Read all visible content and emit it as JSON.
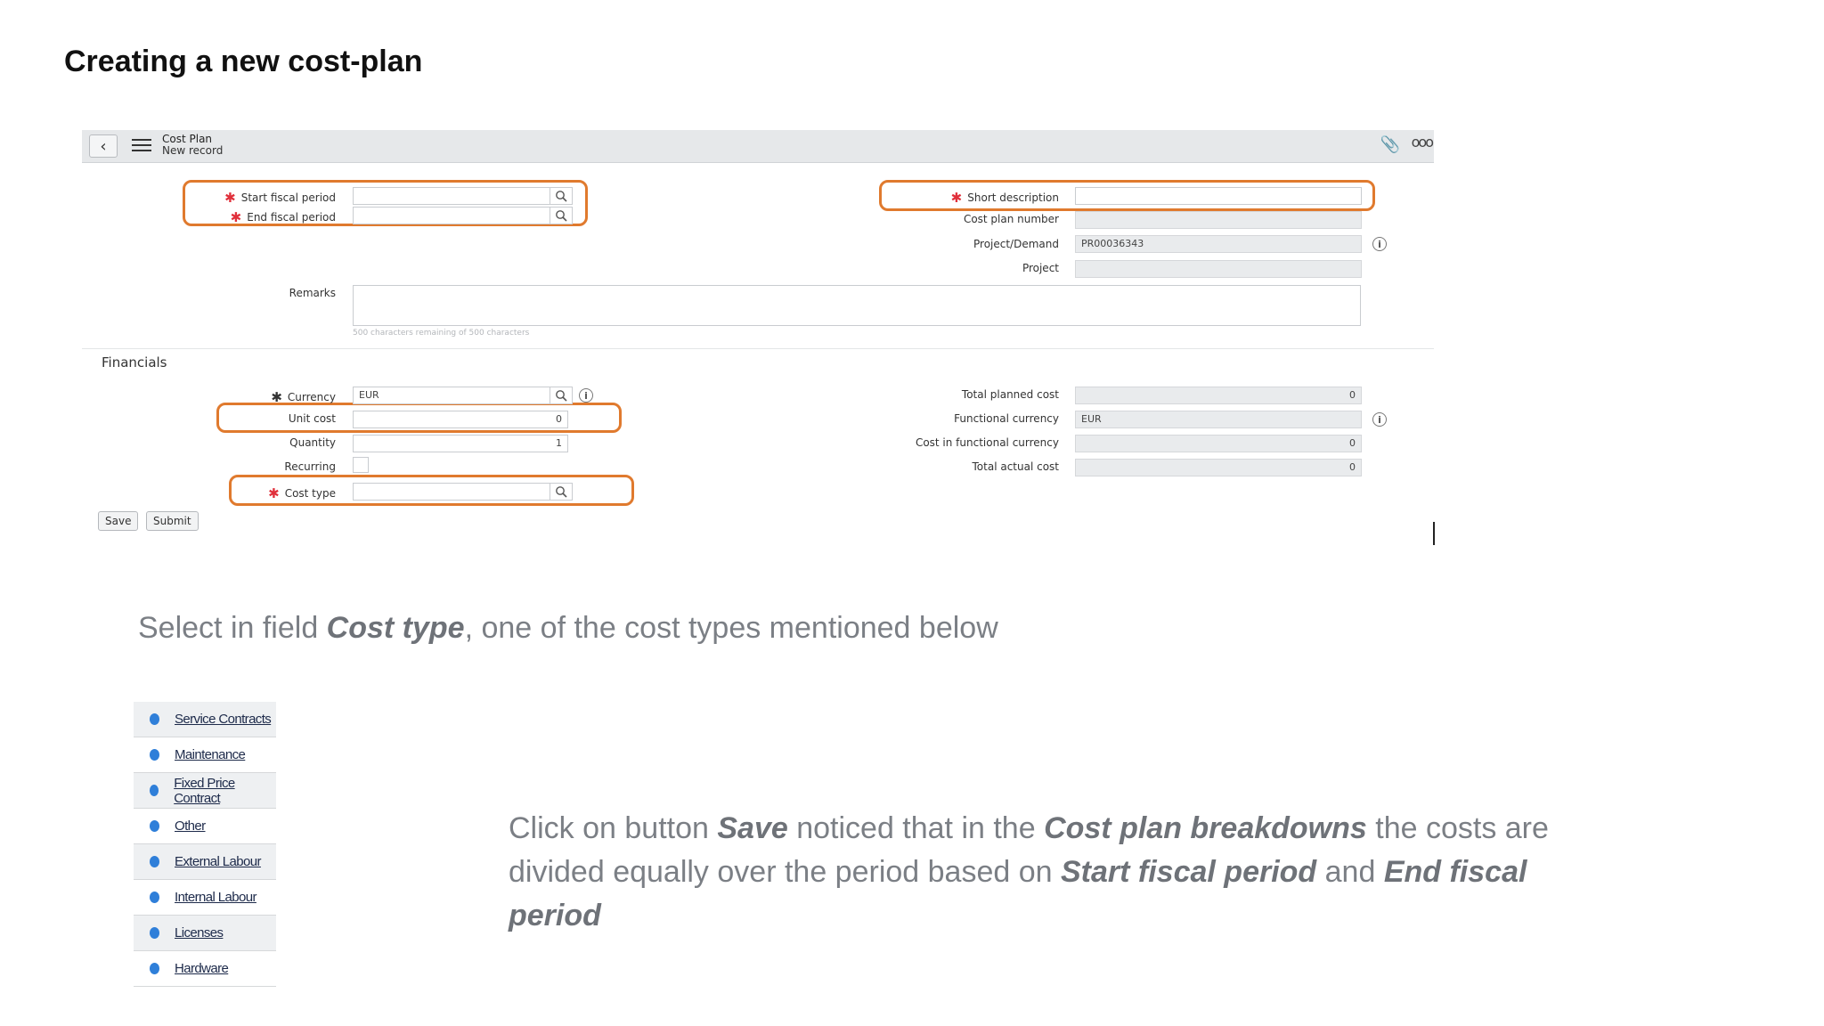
{
  "slide": {
    "title": "Creating a new cost-plan",
    "instruction1": {
      "pre": "Select in field ",
      "em": "Cost type",
      "post": ", one of the cost types mentioned below"
    },
    "instruction2": {
      "p1": "Click on button ",
      "e1": "Save",
      "p2": " noticed that in the ",
      "e2": "Cost plan breakdowns",
      "p3": " the costs are divided equally over the period based on ",
      "e3": "Start fiscal period",
      "p4": " and ",
      "e4": "End fiscal period"
    }
  },
  "form": {
    "header": {
      "title": "Cost Plan",
      "subtitle": "New record"
    },
    "labels": {
      "start_fiscal_period": "Start fiscal period",
      "end_fiscal_period": "End fiscal period",
      "remarks": "Remarks",
      "short_description": "Short description",
      "cost_plan_number": "Cost plan number",
      "project_demand": "Project/Demand",
      "project": "Project",
      "currency": "Currency",
      "unit_cost": "Unit cost",
      "quantity": "Quantity",
      "recurring": "Recurring",
      "cost_type": "Cost type",
      "total_planned_cost": "Total planned cost",
      "functional_currency": "Functional currency",
      "cost_in_functional_currency": "Cost in functional currency",
      "total_actual_cost": "Total actual cost"
    },
    "values": {
      "project_demand": "PR00036343",
      "currency": "EUR",
      "unit_cost": "0",
      "quantity": "1",
      "total_planned_cost": "0",
      "functional_currency": "EUR",
      "cost_in_functional_currency": "0",
      "total_actual_cost": "0"
    },
    "remarks_hint": "500 characters remaining of 500 characters",
    "section_financials": "Financials",
    "buttons": {
      "save": "Save",
      "submit": "Submit"
    },
    "highlight_color": "#e07a2e",
    "required_color": "#e0303b"
  },
  "cost_types": [
    "Service Contracts",
    "Maintenance",
    "Fixed Price Contract",
    "Other",
    "External Labour",
    "Internal Labour",
    "Licenses",
    "Hardware"
  ],
  "icons": {
    "back": "chevron-left-icon",
    "menu": "hamburger-icon",
    "attach": "paperclip-icon",
    "more": "more-icon",
    "search": "search-icon",
    "info": "info-icon",
    "bullet": "bullet-icon"
  }
}
